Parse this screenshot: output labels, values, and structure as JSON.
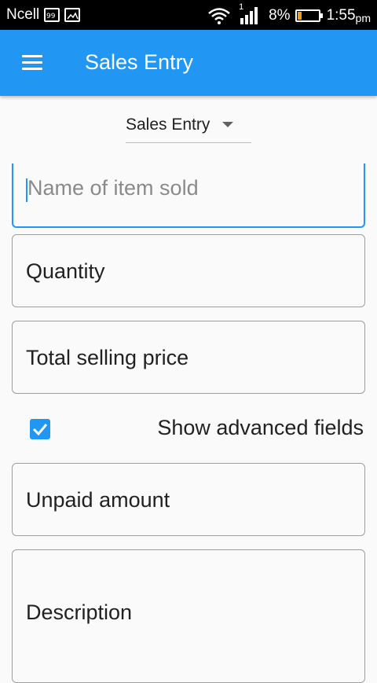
{
  "status_bar": {
    "carrier": "Ncell",
    "signal_sub": "1",
    "battery_percent": "8%",
    "time": "1:55",
    "time_suffix": "pm"
  },
  "app_bar": {
    "title": "Sales Entry",
    "menu_icon": "hamburger-menu-icon"
  },
  "dropdown": {
    "selected": "Sales Entry"
  },
  "fields": {
    "item_name": {
      "placeholder": "Name of item sold",
      "value": ""
    },
    "quantity": {
      "label": "Quantity",
      "value": ""
    },
    "total_price": {
      "label": "Total selling price",
      "value": ""
    },
    "unpaid": {
      "label": "Unpaid amount",
      "value": ""
    },
    "description": {
      "label": "Description",
      "value": ""
    }
  },
  "advanced": {
    "label": "Show advanced fields",
    "checked": true
  },
  "colors": {
    "primary": "#2196f3",
    "background": "#fafafa",
    "statusbar": "#000000"
  }
}
